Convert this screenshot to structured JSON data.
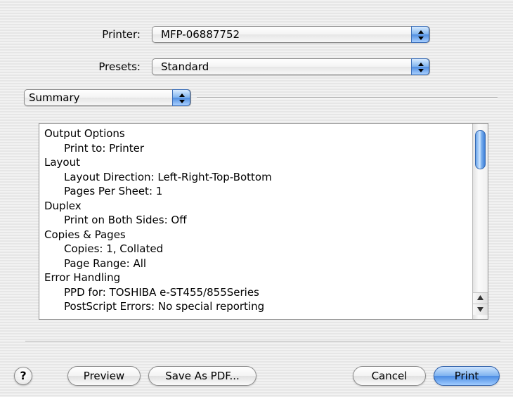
{
  "printer": {
    "label": "Printer:",
    "value": "MFP-06887752"
  },
  "presets": {
    "label": "Presets:",
    "value": "Standard"
  },
  "pane_selector": {
    "value": "Summary"
  },
  "summary": {
    "lines": [
      {
        "text": "Output Options",
        "indent": false
      },
      {
        "text": "Print to:  Printer",
        "indent": true
      },
      {
        "text": "Layout",
        "indent": false
      },
      {
        "text": "Layout Direction:  Left-Right-Top-Bottom",
        "indent": true
      },
      {
        "text": "Pages Per Sheet:  1",
        "indent": true
      },
      {
        "text": "Duplex",
        "indent": false
      },
      {
        "text": "Print on Both Sides:  Off",
        "indent": true
      },
      {
        "text": "Copies & Pages",
        "indent": false
      },
      {
        "text": "Copies:  1, Collated",
        "indent": true
      },
      {
        "text": "Page Range:  All",
        "indent": true
      },
      {
        "text": "Error Handling",
        "indent": false
      },
      {
        "text": "PPD for:  TOSHIBA e-ST455/855Series",
        "indent": true
      },
      {
        "text": "PostScript Errors:  No special reporting",
        "indent": true
      }
    ]
  },
  "buttons": {
    "help": "?",
    "preview": "Preview",
    "save_pdf": "Save As PDF...",
    "cancel": "Cancel",
    "print": "Print"
  },
  "colors": {
    "accent": "#4b8ce3",
    "background": "#ececec"
  }
}
